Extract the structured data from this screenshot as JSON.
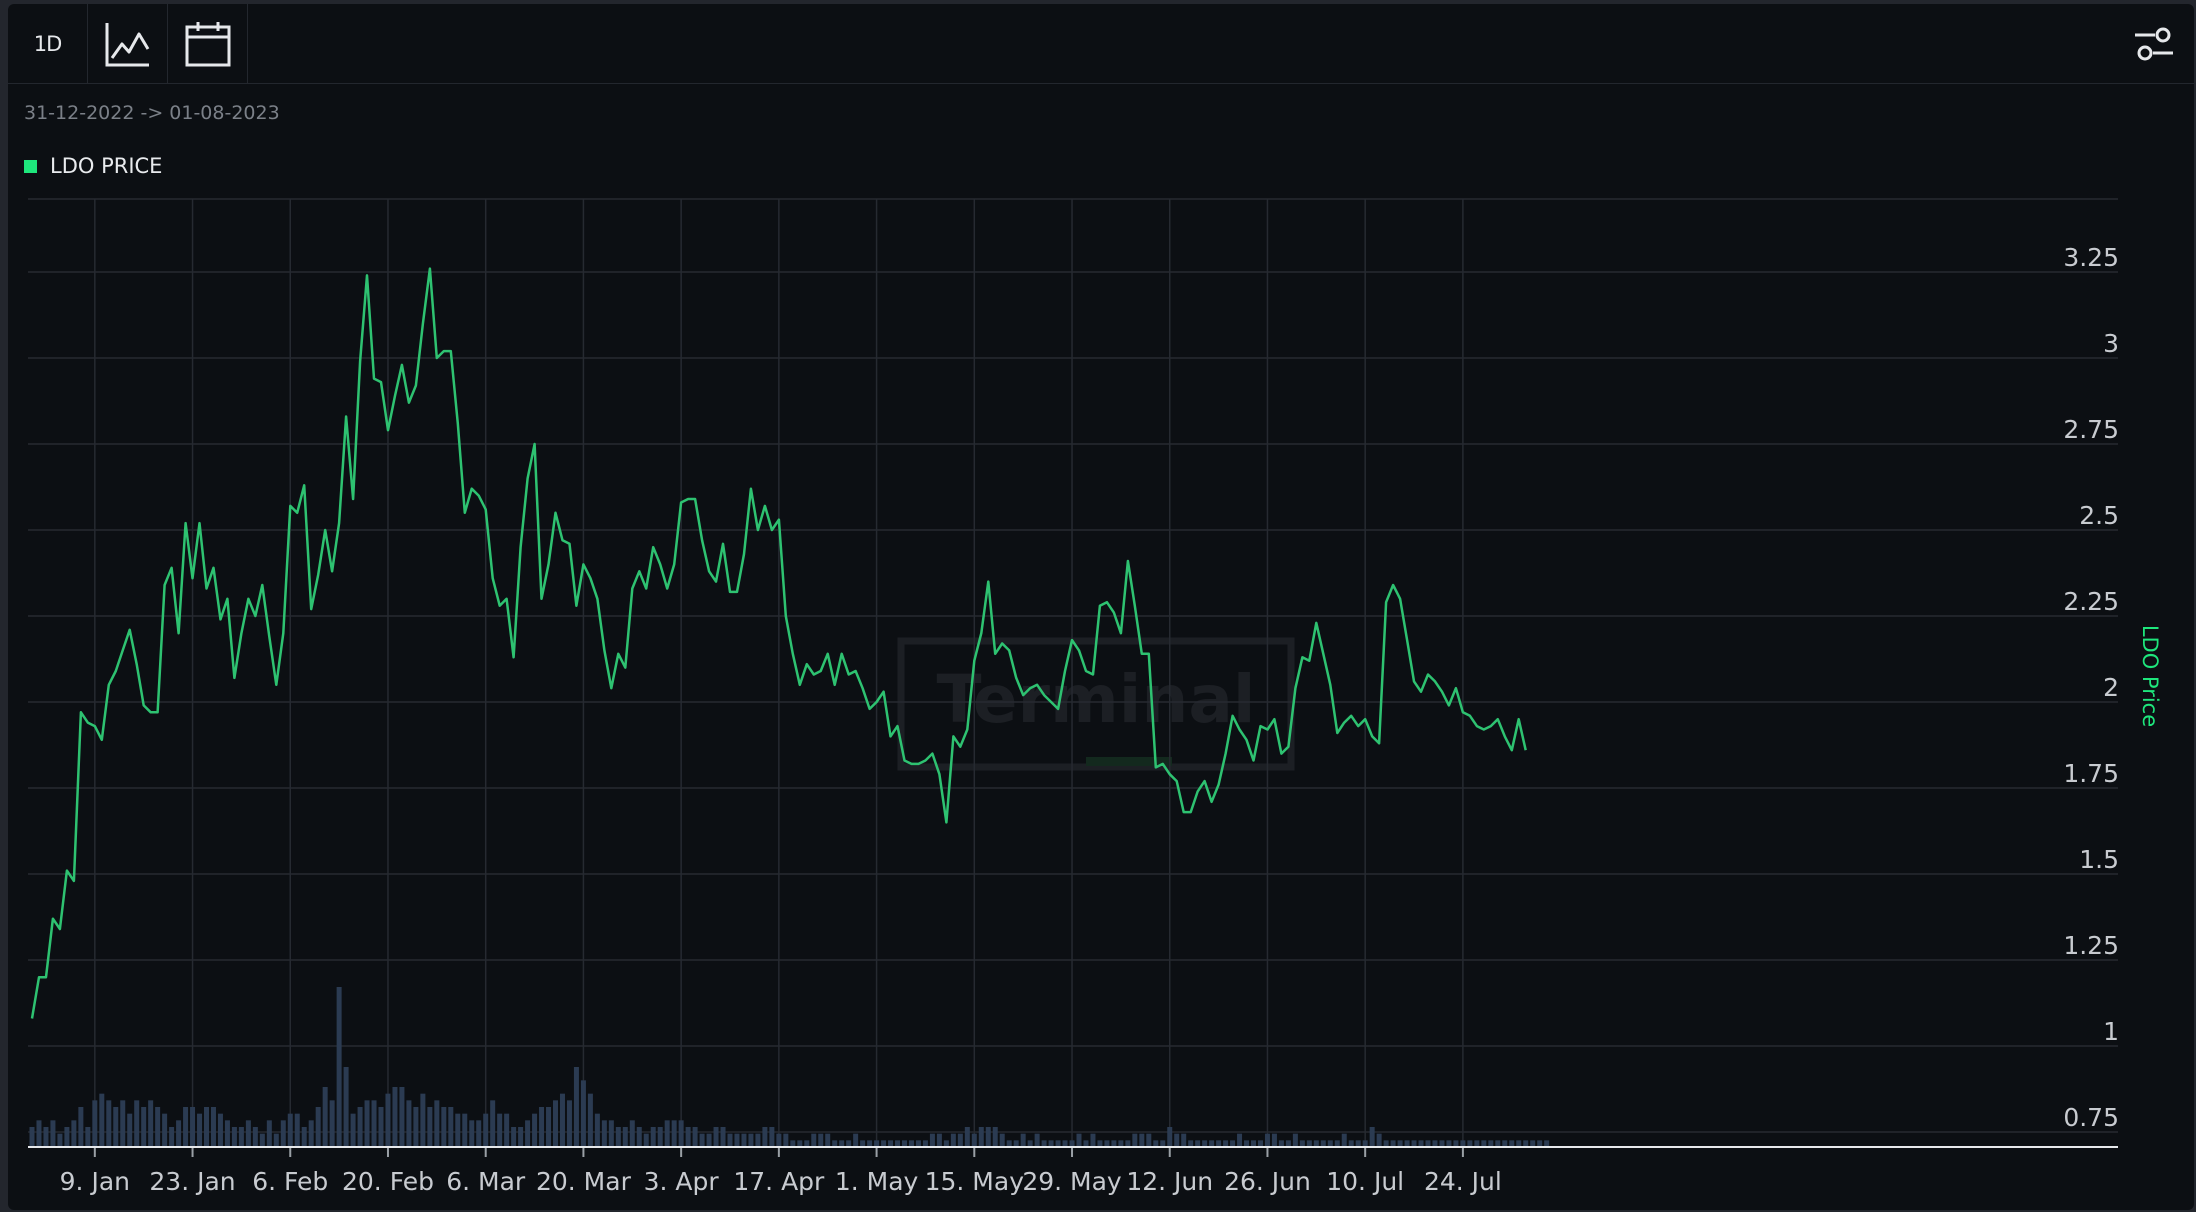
{
  "toolbar": {
    "interval_label": "1D",
    "icons": [
      "line-chart-icon",
      "calendar-icon",
      "settings-sliders-icon"
    ]
  },
  "header": {
    "date_range": "31-12-2022 -> 01-08-2023"
  },
  "legend": {
    "label": "LDO PRICE",
    "color": "#1ee67c"
  },
  "watermark": "Terminal",
  "colors": {
    "line": "#2ec271",
    "volume": "#2b3b52",
    "grid": "#262a31",
    "background": "#0c0f13",
    "axis_label": "#1ee67c"
  },
  "chart_data": {
    "type": "line",
    "start_date": "2022-12-31",
    "interval": "1D",
    "xlabels": [
      {
        "label": "9. Jan",
        "day": 9
      },
      {
        "label": "23. Jan",
        "day": 23
      },
      {
        "label": "6. Feb",
        "day": 37
      },
      {
        "label": "20. Feb",
        "day": 51
      },
      {
        "label": "6. Mar",
        "day": 65
      },
      {
        "label": "20. Mar",
        "day": 79
      },
      {
        "label": "3. Apr",
        "day": 93
      },
      {
        "label": "17. Apr",
        "day": 107
      },
      {
        "label": "1. May",
        "day": 121
      },
      {
        "label": "15. May",
        "day": 135
      },
      {
        "label": "29. May",
        "day": 149
      },
      {
        "label": "12. Jun",
        "day": 163
      },
      {
        "label": "26. Jun",
        "day": 177
      },
      {
        "label": "10. Jul",
        "day": 191
      },
      {
        "label": "24. Jul",
        "day": 205
      }
    ],
    "ylabel": "LDO Price",
    "yticks": [
      0.75,
      1,
      1.25,
      1.5,
      1.75,
      2,
      2.25,
      2.5,
      2.75,
      3,
      3.25
    ],
    "ylim": [
      0.7,
      3.5
    ],
    "xlim": [
      0,
      213
    ],
    "series": [
      {
        "name": "LDO Price",
        "values": [
          1.08,
          1.2,
          1.2,
          1.37,
          1.34,
          1.51,
          1.48,
          1.97,
          1.94,
          1.93,
          1.89,
          2.05,
          2.09,
          2.15,
          2.21,
          2.11,
          1.99,
          1.97,
          1.97,
          2.34,
          2.39,
          2.2,
          2.52,
          2.36,
          2.52,
          2.33,
          2.39,
          2.24,
          2.3,
          2.07,
          2.2,
          2.3,
          2.25,
          2.34,
          2.19,
          2.05,
          2.2,
          2.57,
          2.55,
          2.63,
          2.27,
          2.37,
          2.5,
          2.38,
          2.52,
          2.83,
          2.59,
          2.99,
          3.24,
          2.94,
          2.93,
          2.79,
          2.89,
          2.98,
          2.87,
          2.92,
          3.1,
          3.26,
          3.0,
          3.02,
          3.02,
          2.81,
          2.55,
          2.62,
          2.6,
          2.56,
          2.36,
          2.28,
          2.3,
          2.13,
          2.45,
          2.65,
          2.75,
          2.3,
          2.4,
          2.55,
          2.47,
          2.46,
          2.28,
          2.4,
          2.36,
          2.3,
          2.15,
          2.04,
          2.14,
          2.1,
          2.33,
          2.38,
          2.33,
          2.45,
          2.4,
          2.33,
          2.4,
          2.58,
          2.59,
          2.59,
          2.47,
          2.38,
          2.35,
          2.46,
          2.32,
          2.32,
          2.43,
          2.62,
          2.5,
          2.57,
          2.5,
          2.53,
          2.25,
          2.14,
          2.05,
          2.11,
          2.08,
          2.09,
          2.14,
          2.05,
          2.14,
          2.08,
          2.09,
          2.04,
          1.98,
          2.0,
          2.03,
          1.9,
          1.93,
          1.83,
          1.82,
          1.82,
          1.83,
          1.85,
          1.79,
          1.65,
          1.9,
          1.87,
          1.92,
          2.12,
          2.2,
          2.35,
          2.14,
          2.17,
          2.15,
          2.07,
          2.02,
          2.04,
          2.05,
          2.02,
          2.0,
          1.98,
          2.09,
          2.18,
          2.15,
          2.09,
          2.08,
          2.28,
          2.29,
          2.26,
          2.2,
          2.41,
          2.28,
          2.14,
          2.14,
          1.81,
          1.82,
          1.79,
          1.77,
          1.68,
          1.68,
          1.74,
          1.77,
          1.71,
          1.76,
          1.85,
          1.96,
          1.92,
          1.89,
          1.83,
          1.93,
          1.92,
          1.95,
          1.85,
          1.87,
          2.04,
          2.13,
          2.12,
          2.23,
          2.14,
          2.05,
          1.91,
          1.94,
          1.96,
          1.93,
          1.95,
          1.9,
          1.88,
          2.29,
          2.34,
          2.3,
          2.18,
          2.06,
          2.03,
          2.08,
          2.06,
          2.03,
          1.99,
          2.04,
          1.97,
          1.96,
          1.93,
          1.92,
          1.93,
          1.95,
          1.9,
          1.86,
          1.95,
          1.86
        ]
      }
    ],
    "volume": {
      "values": [
        3,
        4,
        3,
        4,
        2,
        3,
        4,
        6,
        3,
        7,
        8,
        7,
        6,
        7,
        5,
        7,
        6,
        7,
        6,
        5,
        3,
        4,
        6,
        6,
        5,
        6,
        6,
        5,
        4,
        3,
        3,
        4,
        3,
        2,
        4,
        2,
        4,
        5,
        5,
        3,
        4,
        6,
        9,
        7,
        24,
        12,
        5,
        6,
        7,
        7,
        6,
        8,
        9,
        9,
        7,
        6,
        8,
        6,
        7,
        6,
        6,
        5,
        5,
        4,
        4,
        5,
        7,
        5,
        5,
        3,
        3,
        4,
        5,
        6,
        6,
        7,
        8,
        7,
        12,
        10,
        8,
        5,
        4,
        4,
        3,
        3,
        4,
        3,
        2,
        3,
        3,
        4,
        4,
        4,
        3,
        3,
        2,
        2,
        3,
        3,
        2,
        2,
        2,
        2,
        2,
        3,
        3,
        2,
        2,
        1,
        1,
        1,
        2,
        2,
        2,
        1,
        1,
        1,
        2,
        1,
        1,
        1,
        1,
        1,
        1,
        1,
        1,
        1,
        1,
        2,
        2,
        1,
        2,
        2,
        3,
        2,
        3,
        3,
        3,
        2,
        1,
        1,
        2,
        1,
        2,
        1,
        1,
        1,
        1,
        1,
        2,
        1,
        2,
        1,
        1,
        1,
        1,
        1,
        2,
        2,
        2,
        1,
        1,
        3,
        2,
        2,
        1,
        1,
        1,
        1,
        1,
        1,
        1,
        2,
        1,
        1,
        1,
        2,
        2,
        1,
        1,
        2,
        1,
        1,
        1,
        1,
        1,
        1,
        2,
        1,
        1,
        1,
        3,
        2,
        1,
        1,
        1,
        1,
        1,
        1,
        1,
        1,
        1,
        1,
        1,
        1,
        1,
        1,
        1,
        1,
        1,
        1,
        1,
        1,
        1,
        1,
        1,
        1
      ]
    }
  }
}
